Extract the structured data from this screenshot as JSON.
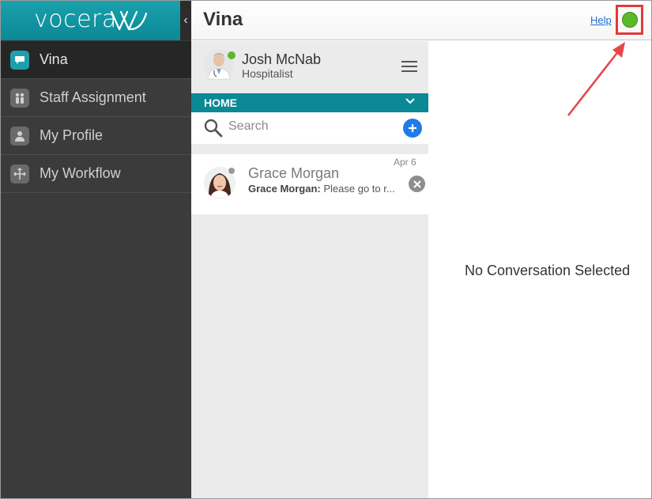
{
  "sidebar": {
    "logo_text": "vocera",
    "collapse_glyph": "‹",
    "items": [
      {
        "label": "Vina",
        "icon": "chat-bubble-icon",
        "active": true
      },
      {
        "label": "Staff Assignment",
        "icon": "staff-icon",
        "active": false
      },
      {
        "label": "My Profile",
        "icon": "person-icon",
        "active": false
      },
      {
        "label": "My Workflow",
        "icon": "workflow-icon",
        "active": false
      }
    ]
  },
  "header": {
    "title": "Vina",
    "help_label": "Help",
    "status_color": "#5ab82b"
  },
  "profile": {
    "name": "Josh McNab",
    "role": "Hospitalist",
    "presence_color": "#5ab82b"
  },
  "home_bar": {
    "label": "HOME"
  },
  "search": {
    "placeholder": "Search",
    "value": ""
  },
  "conversations": [
    {
      "name": "Grace Morgan",
      "sender": "Grace Morgan:",
      "preview": "Please go to r...",
      "date": "Apr 6"
    }
  ],
  "main": {
    "empty_message": "No Conversation Selected"
  },
  "colors": {
    "accent": "#0b8995",
    "sidebar_bg": "#3b3b3b",
    "compose_blue": "#1e7be8",
    "annotation_red": "#e03b3b"
  }
}
